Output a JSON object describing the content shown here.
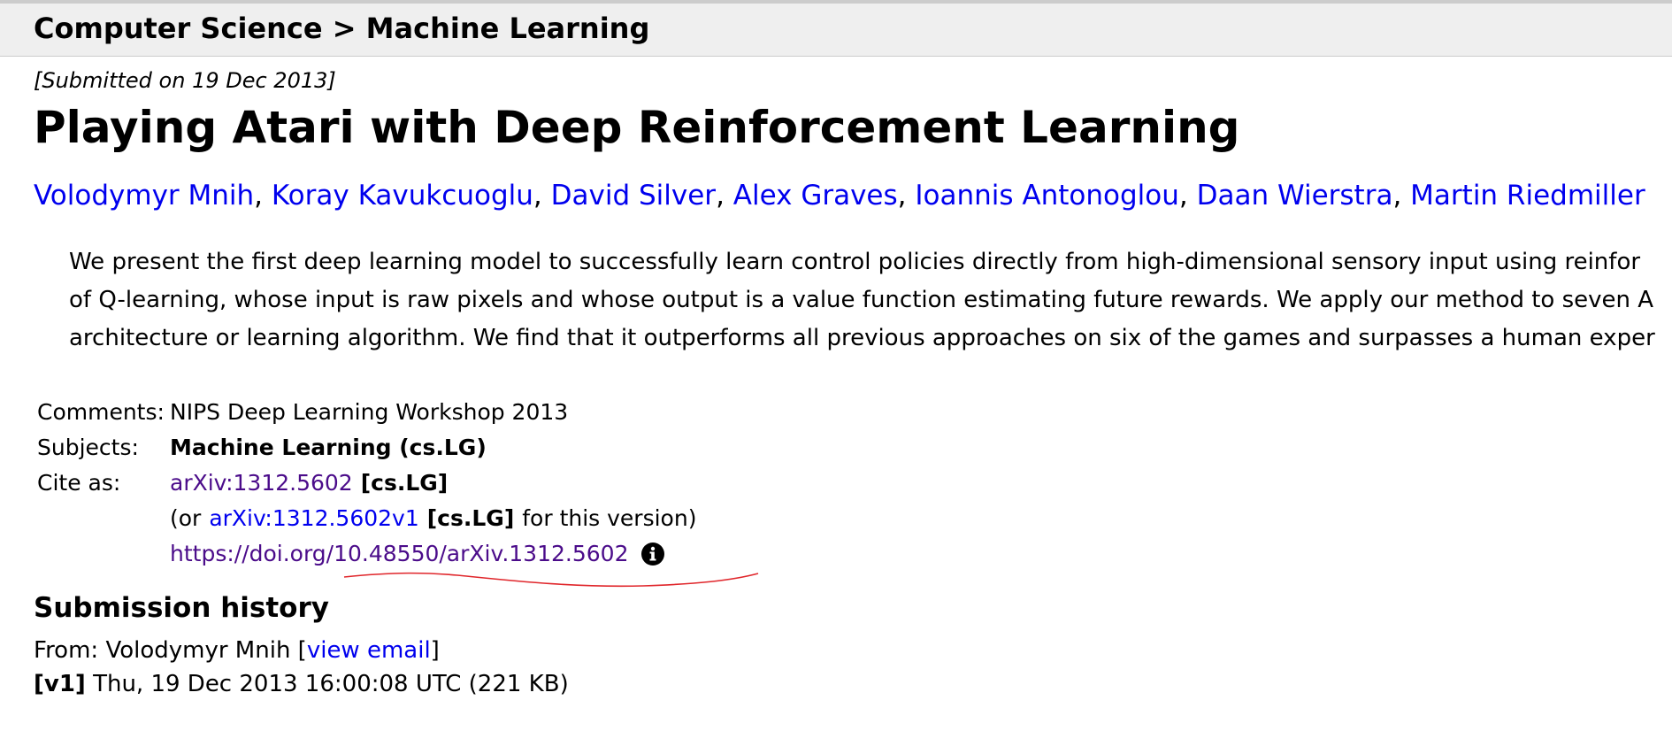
{
  "breadcrumb": {
    "text": "Computer Science > Machine Learning"
  },
  "submitted": "[Submitted on 19 Dec 2013]",
  "title": "Playing Atari with Deep Reinforcement Learning",
  "authors": [
    "Volodymyr Mnih",
    "Koray Kavukcuoglu",
    "David Silver",
    "Alex Graves",
    "Ioannis Antonoglou",
    "Daan Wierstra",
    "Martin Riedmiller"
  ],
  "author_separator": ",",
  "abstract": {
    "lines": [
      "We present the first deep learning model to successfully learn control policies directly from high-dimensional sensory input using reinfor",
      "of Q-learning, whose input is raw pixels and whose output is a value function estimating future rewards. We apply our method to seven A",
      "architecture or learning algorithm. We find that it outperforms all previous approaches on six of the games and surpasses a human exper"
    ]
  },
  "meta": {
    "comments_label": "Comments:",
    "comments_value": "NIPS Deep Learning Workshop 2013",
    "subjects_label": "Subjects:",
    "subjects_value": "Machine Learning (cs.LG)",
    "cite_label": "Cite as:",
    "cite_id": "arXiv:1312.5602",
    "cite_category": "[cs.LG]",
    "version_prefix": "(or",
    "version_id": "arXiv:1312.5602v1",
    "version_category": "[cs.LG]",
    "version_suffix": "for this version)",
    "doi_url": "https://doi.org/10.48550/arXiv.1312.5602",
    "info_icon": "info-circle-icon"
  },
  "history": {
    "title": "Submission history",
    "from_prefix": "From: Volodymyr Mnih [",
    "view_email": "view email",
    "from_suffix": "]",
    "version_tag": "[v1]",
    "version_details": "Thu, 19 Dec 2013 16:00:08 UTC (221 KB)"
  },
  "colors": {
    "link": "#0000ee",
    "visited_link": "#4b0c8a",
    "header_bg": "#efefef",
    "annotation_red": "#e0262b"
  }
}
